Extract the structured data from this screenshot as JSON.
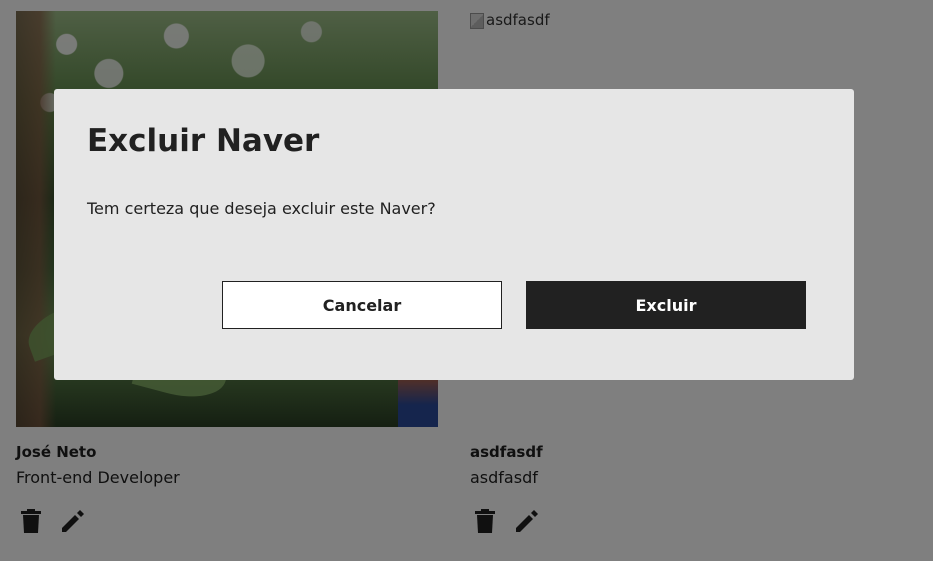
{
  "cards": [
    {
      "name": "José Neto",
      "job_role": "Front-end Developer",
      "photo_alt": ""
    },
    {
      "name": "asdfasdf",
      "job_role": "asdfasdf",
      "photo_alt": "asdfasdf"
    }
  ],
  "modal": {
    "title": "Excluir Naver",
    "message": "Tem certeza que deseja excluir este Naver?",
    "cancel_label": "Cancelar",
    "confirm_label": "Excluir"
  },
  "icons": {
    "delete": "trash-icon",
    "edit": "pencil-icon"
  },
  "colors": {
    "primary": "#212121",
    "modal_bg": "#e6e6e6",
    "overlay": "rgba(0,0,0,0.5)"
  }
}
